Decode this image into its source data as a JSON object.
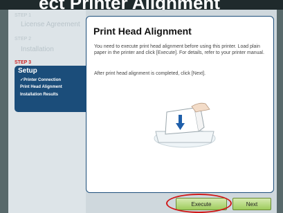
{
  "banner": {
    "text": "ect Printer Alignment"
  },
  "sidebar": {
    "step1": {
      "label": "STEP 1",
      "title": "License Agreement"
    },
    "step2": {
      "label": "STEP 2",
      "title": "Installation"
    },
    "step3": {
      "label": "STEP 3",
      "title": "Setup"
    },
    "items": [
      {
        "label": "Printer Connection"
      },
      {
        "label": "Print Head Alignment"
      },
      {
        "label": "Installation Results"
      }
    ]
  },
  "main": {
    "title": "Print Head Alignment",
    "paragraph1": "You need to execute print head alignment before using this printer. Load plain paper in the printer and click [Execute]. For details, refer to your printer manual.",
    "paragraph2": "After print head alignment is completed, click [Next]."
  },
  "buttons": {
    "execute": "Execute",
    "next": "Next"
  },
  "colors": {
    "accent": "#1b4d7a",
    "button_green": "#9dcc5c",
    "highlight": "#d01818",
    "step_active": "#cc2222"
  }
}
